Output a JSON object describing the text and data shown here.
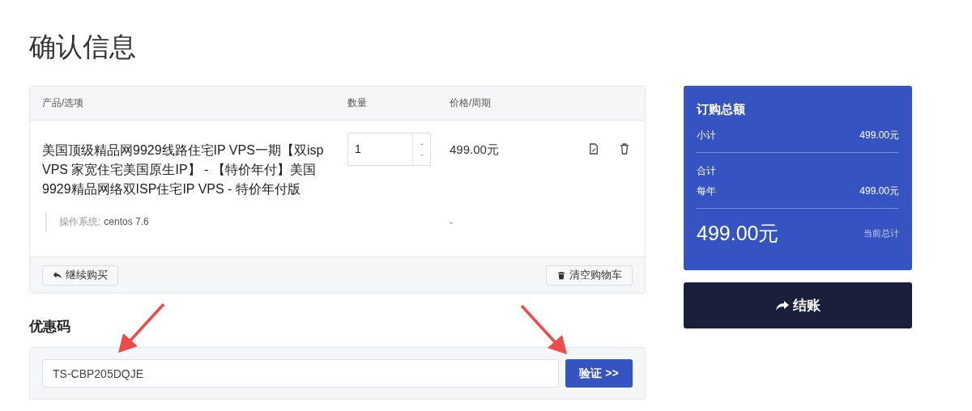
{
  "page_title": "确认信息",
  "cart": {
    "columns": [
      "产品/选项",
      "数量",
      "价格/周期"
    ],
    "items": [
      {
        "name": "美国顶级精品网9929线路住宅IP VPS一期【双isp VPS 家宽住宅美国原生IP】 - 【特价年付】美国9929精品网络双ISP住宅IP VPS - 特价年付版",
        "quantity": "1",
        "price": "499.00元",
        "options": [
          {
            "label": "操作系统:",
            "value": "centos 7.6"
          }
        ],
        "option_price": "-"
      }
    ],
    "continue_button": "继续购买",
    "empty_button": "清空购物车"
  },
  "promo": {
    "title": "优惠码",
    "value": "TS-CBP205DQJE",
    "button": "验证 >>"
  },
  "summary": {
    "title": "订购总额",
    "subtotal": {
      "label": "小计",
      "value": "499.00元"
    },
    "total_label": "合计",
    "recurring": {
      "label": "每年",
      "value": "499.00元"
    },
    "total": "499.00元",
    "total_caption": "当前总计"
  },
  "checkout_button": "结账"
}
